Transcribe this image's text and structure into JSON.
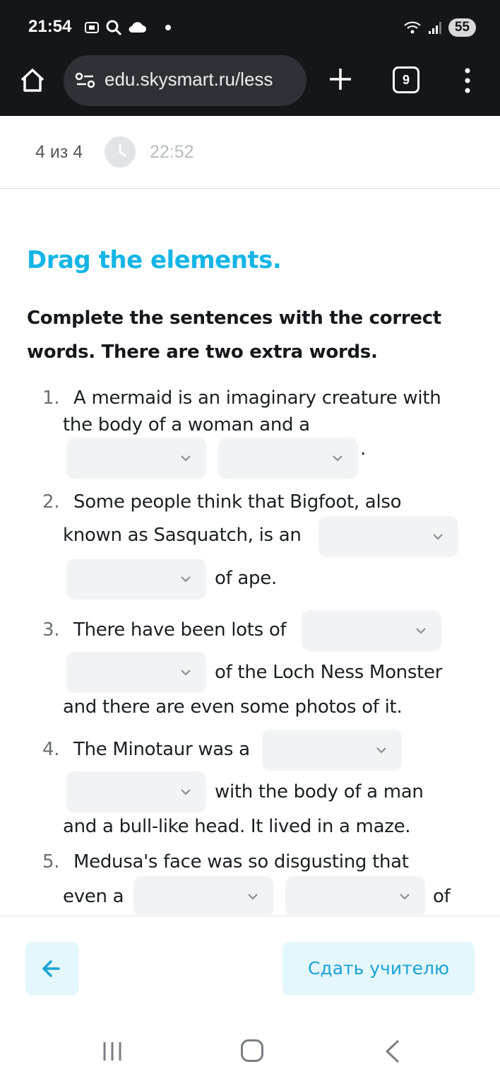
{
  "status_bar": {
    "time": "21:54",
    "battery": "55",
    "icons": [
      "screenshot-icon",
      "search-icon",
      "cloud-icon",
      "notification-dot",
      "wifi-icon",
      "signal-icon"
    ]
  },
  "browser": {
    "url": "edu.skysmart.ru/less",
    "tab_count": "9"
  },
  "progress": {
    "label": "4 из 4",
    "timer": "22:52"
  },
  "task": {
    "title": "Drag the elements.",
    "instructions": "Complete the sentences with the correct words. There are two extra words."
  },
  "questions": [
    {
      "num": "1.",
      "lines": [
        "A mermaid is an imaginary creature with",
        "the body of a woman and a",
        "."
      ]
    },
    {
      "num": "2.",
      "lines": [
        "Some people think that Bigfoot, also",
        "known as Sasquatch, is an",
        "of ape."
      ]
    },
    {
      "num": "3.",
      "lines": [
        "There have been lots of",
        "of the Loch Ness Monster",
        "and there are even some photos of it."
      ]
    },
    {
      "num": "4.",
      "lines": [
        "The Minotaur was a",
        "with the body of a man",
        "and a bull-like head. It lived in a maze."
      ]
    },
    {
      "num": "5.",
      "lines": [
        "Medusa's face was so disgusting that",
        "even a",
        "of"
      ]
    }
  ],
  "actions": {
    "submit_label": "Сдать учителю"
  },
  "colors": {
    "accent": "#15b5e6",
    "button_bg": "#e4f7fd",
    "dropdown_bg": "#f1f3f5",
    "dark_bar": "#141619"
  }
}
